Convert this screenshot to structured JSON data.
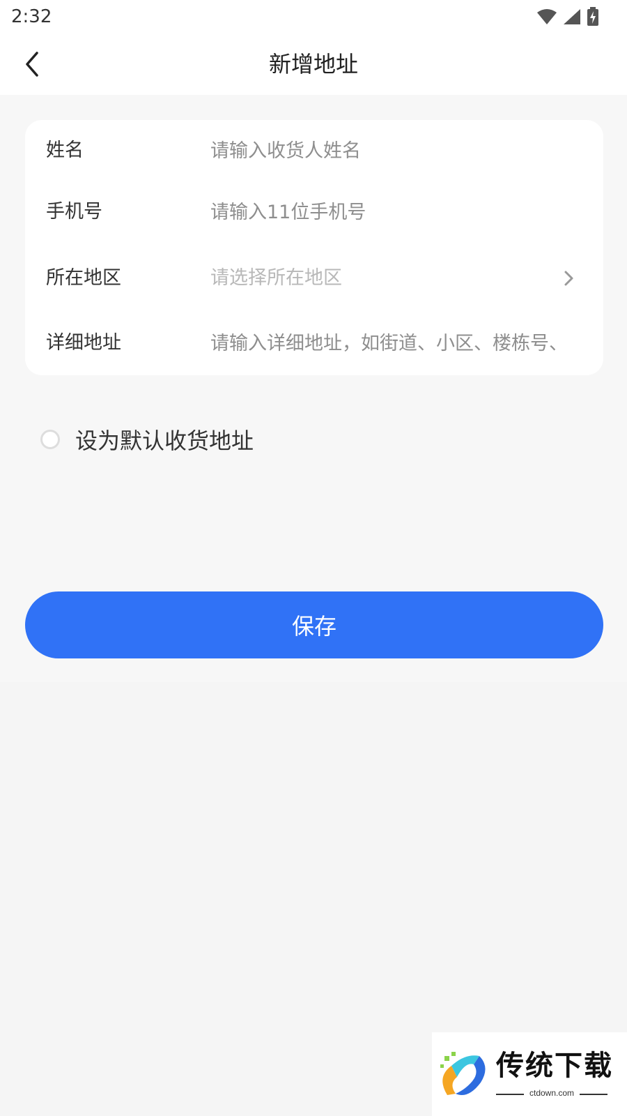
{
  "status_bar": {
    "time": "2:32",
    "icons": [
      "wifi-icon",
      "signal-icon",
      "battery-charging-icon"
    ]
  },
  "nav": {
    "back_icon": "chevron-left-icon",
    "title": "新增地址"
  },
  "form": {
    "name": {
      "label": "姓名",
      "value": "",
      "placeholder": "请输入收货人姓名"
    },
    "phone": {
      "label": "手机号",
      "value": "",
      "placeholder": "请输入11位手机号"
    },
    "region": {
      "label": "所在地区",
      "placeholder": "请选择所在地区",
      "icon": "chevron-right-icon"
    },
    "detail": {
      "label": "详细地址",
      "value": "",
      "placeholder": "请输入详细地址，如街道、小区、楼栋号、"
    }
  },
  "default_address": {
    "label": "设为默认收货地址",
    "checked": false
  },
  "save_button": {
    "label": "保存"
  },
  "watermark": {
    "title": "传统下载",
    "url": "ctdown.com"
  },
  "colors": {
    "primary": "#3072f6",
    "background": "#f5f5f5",
    "card": "#ffffff",
    "text": "#333333",
    "placeholder": "#8e8e8e"
  }
}
